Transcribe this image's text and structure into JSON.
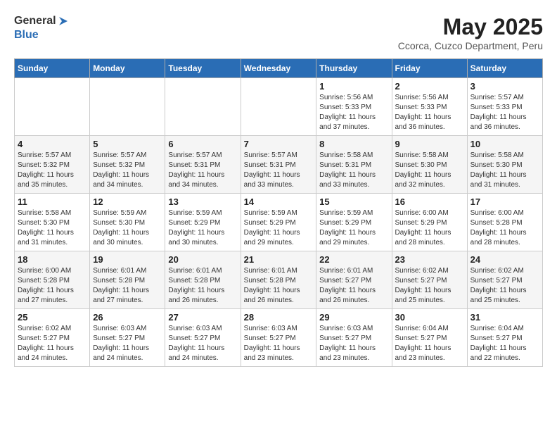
{
  "logo": {
    "text_general": "General",
    "text_blue": "Blue"
  },
  "title": {
    "month_year": "May 2025",
    "location": "Ccorca, Cuzco Department, Peru"
  },
  "days_of_week": [
    "Sunday",
    "Monday",
    "Tuesday",
    "Wednesday",
    "Thursday",
    "Friday",
    "Saturday"
  ],
  "weeks": [
    [
      {
        "day": "",
        "info": ""
      },
      {
        "day": "",
        "info": ""
      },
      {
        "day": "",
        "info": ""
      },
      {
        "day": "",
        "info": ""
      },
      {
        "day": "1",
        "info": "Sunrise: 5:56 AM\nSunset: 5:33 PM\nDaylight: 11 hours and 37 minutes."
      },
      {
        "day": "2",
        "info": "Sunrise: 5:56 AM\nSunset: 5:33 PM\nDaylight: 11 hours and 36 minutes."
      },
      {
        "day": "3",
        "info": "Sunrise: 5:57 AM\nSunset: 5:33 PM\nDaylight: 11 hours and 36 minutes."
      }
    ],
    [
      {
        "day": "4",
        "info": "Sunrise: 5:57 AM\nSunset: 5:32 PM\nDaylight: 11 hours and 35 minutes."
      },
      {
        "day": "5",
        "info": "Sunrise: 5:57 AM\nSunset: 5:32 PM\nDaylight: 11 hours and 34 minutes."
      },
      {
        "day": "6",
        "info": "Sunrise: 5:57 AM\nSunset: 5:31 PM\nDaylight: 11 hours and 34 minutes."
      },
      {
        "day": "7",
        "info": "Sunrise: 5:57 AM\nSunset: 5:31 PM\nDaylight: 11 hours and 33 minutes."
      },
      {
        "day": "8",
        "info": "Sunrise: 5:58 AM\nSunset: 5:31 PM\nDaylight: 11 hours and 33 minutes."
      },
      {
        "day": "9",
        "info": "Sunrise: 5:58 AM\nSunset: 5:30 PM\nDaylight: 11 hours and 32 minutes."
      },
      {
        "day": "10",
        "info": "Sunrise: 5:58 AM\nSunset: 5:30 PM\nDaylight: 11 hours and 31 minutes."
      }
    ],
    [
      {
        "day": "11",
        "info": "Sunrise: 5:58 AM\nSunset: 5:30 PM\nDaylight: 11 hours and 31 minutes."
      },
      {
        "day": "12",
        "info": "Sunrise: 5:59 AM\nSunset: 5:30 PM\nDaylight: 11 hours and 30 minutes."
      },
      {
        "day": "13",
        "info": "Sunrise: 5:59 AM\nSunset: 5:29 PM\nDaylight: 11 hours and 30 minutes."
      },
      {
        "day": "14",
        "info": "Sunrise: 5:59 AM\nSunset: 5:29 PM\nDaylight: 11 hours and 29 minutes."
      },
      {
        "day": "15",
        "info": "Sunrise: 5:59 AM\nSunset: 5:29 PM\nDaylight: 11 hours and 29 minutes."
      },
      {
        "day": "16",
        "info": "Sunrise: 6:00 AM\nSunset: 5:29 PM\nDaylight: 11 hours and 28 minutes."
      },
      {
        "day": "17",
        "info": "Sunrise: 6:00 AM\nSunset: 5:28 PM\nDaylight: 11 hours and 28 minutes."
      }
    ],
    [
      {
        "day": "18",
        "info": "Sunrise: 6:00 AM\nSunset: 5:28 PM\nDaylight: 11 hours and 27 minutes."
      },
      {
        "day": "19",
        "info": "Sunrise: 6:01 AM\nSunset: 5:28 PM\nDaylight: 11 hours and 27 minutes."
      },
      {
        "day": "20",
        "info": "Sunrise: 6:01 AM\nSunset: 5:28 PM\nDaylight: 11 hours and 26 minutes."
      },
      {
        "day": "21",
        "info": "Sunrise: 6:01 AM\nSunset: 5:28 PM\nDaylight: 11 hours and 26 minutes."
      },
      {
        "day": "22",
        "info": "Sunrise: 6:01 AM\nSunset: 5:27 PM\nDaylight: 11 hours and 26 minutes."
      },
      {
        "day": "23",
        "info": "Sunrise: 6:02 AM\nSunset: 5:27 PM\nDaylight: 11 hours and 25 minutes."
      },
      {
        "day": "24",
        "info": "Sunrise: 6:02 AM\nSunset: 5:27 PM\nDaylight: 11 hours and 25 minutes."
      }
    ],
    [
      {
        "day": "25",
        "info": "Sunrise: 6:02 AM\nSunset: 5:27 PM\nDaylight: 11 hours and 24 minutes."
      },
      {
        "day": "26",
        "info": "Sunrise: 6:03 AM\nSunset: 5:27 PM\nDaylight: 11 hours and 24 minutes."
      },
      {
        "day": "27",
        "info": "Sunrise: 6:03 AM\nSunset: 5:27 PM\nDaylight: 11 hours and 24 minutes."
      },
      {
        "day": "28",
        "info": "Sunrise: 6:03 AM\nSunset: 5:27 PM\nDaylight: 11 hours and 23 minutes."
      },
      {
        "day": "29",
        "info": "Sunrise: 6:03 AM\nSunset: 5:27 PM\nDaylight: 11 hours and 23 minutes."
      },
      {
        "day": "30",
        "info": "Sunrise: 6:04 AM\nSunset: 5:27 PM\nDaylight: 11 hours and 23 minutes."
      },
      {
        "day": "31",
        "info": "Sunrise: 6:04 AM\nSunset: 5:27 PM\nDaylight: 11 hours and 22 minutes."
      }
    ]
  ]
}
